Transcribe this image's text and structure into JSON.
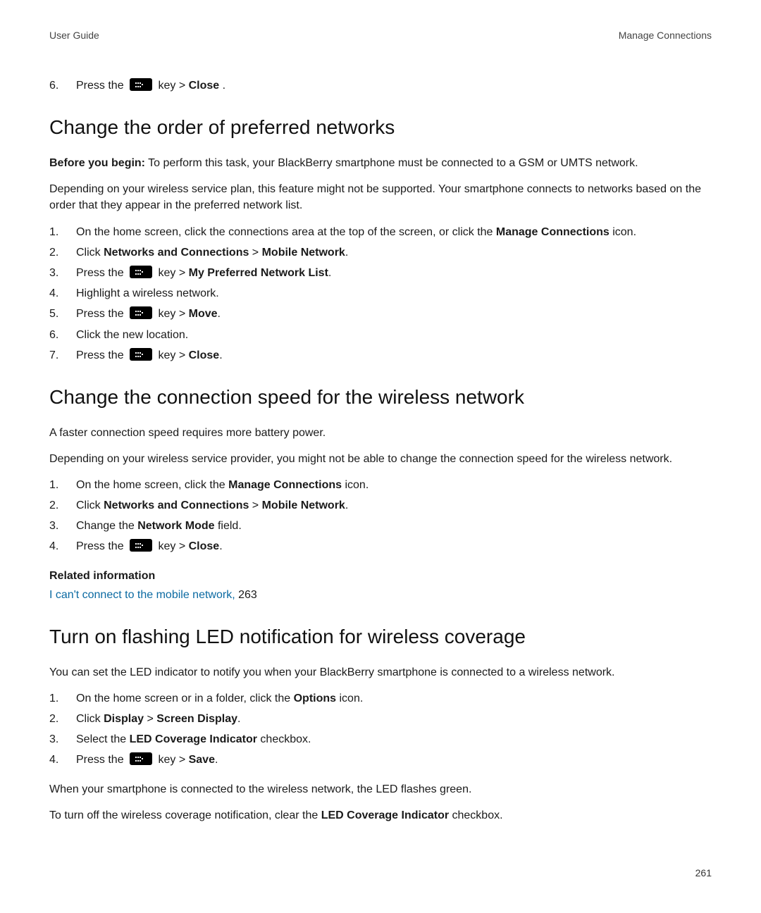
{
  "header": {
    "left": "User Guide",
    "right": "Manage Connections"
  },
  "preStep": {
    "num": "6.",
    "pre": "Press the ",
    "post": " key > ",
    "bold": "Close",
    "tail": "."
  },
  "s1": {
    "title": "Change the order of preferred networks",
    "beforeLabel": "Before you begin:",
    "beforeText": " To perform this task, your BlackBerry smartphone must be connected to a GSM or UMTS network.",
    "para2": "Depending on your wireless service plan, this feature might not be supported. Your smartphone connects to networks based on the order that they appear in the preferred network list.",
    "steps": [
      {
        "num": "1.",
        "parts": [
          {
            "t": "On the home screen, click the connections area at the top of the screen, or click the "
          },
          {
            "t": "Manage Connections",
            "b": true
          },
          {
            "t": " icon."
          }
        ]
      },
      {
        "num": "2.",
        "parts": [
          {
            "t": "Click "
          },
          {
            "t": "Networks and Connections",
            "b": true
          },
          {
            "t": " > "
          },
          {
            "t": "Mobile Network",
            "b": true
          },
          {
            "t": "."
          }
        ]
      },
      {
        "num": "3.",
        "parts": [
          {
            "t": "Press the "
          },
          {
            "icon": true
          },
          {
            "t": " key > "
          },
          {
            "t": "My Preferred Network List",
            "b": true
          },
          {
            "t": "."
          }
        ]
      },
      {
        "num": "4.",
        "parts": [
          {
            "t": "Highlight a wireless network."
          }
        ]
      },
      {
        "num": "5.",
        "parts": [
          {
            "t": "Press the "
          },
          {
            "icon": true
          },
          {
            "t": " key > "
          },
          {
            "t": "Move",
            "b": true
          },
          {
            "t": "."
          }
        ]
      },
      {
        "num": "6.",
        "parts": [
          {
            "t": "Click the new location."
          }
        ]
      },
      {
        "num": "7.",
        "parts": [
          {
            "t": "Press the "
          },
          {
            "icon": true
          },
          {
            "t": " key > "
          },
          {
            "t": "Close",
            "b": true
          },
          {
            "t": "."
          }
        ]
      }
    ]
  },
  "s2": {
    "title": "Change the connection speed for the wireless network",
    "para1": "A faster connection speed requires more battery power.",
    "para2": "Depending on your wireless service provider, you might not be able to change the connection speed for the wireless network.",
    "steps": [
      {
        "num": "1.",
        "parts": [
          {
            "t": "On the home screen, click the "
          },
          {
            "t": "Manage Connections",
            "b": true
          },
          {
            "t": " icon."
          }
        ]
      },
      {
        "num": "2.",
        "parts": [
          {
            "t": "Click "
          },
          {
            "t": "Networks and Connections",
            "b": true
          },
          {
            "t": " > "
          },
          {
            "t": "Mobile Network",
            "b": true
          },
          {
            "t": "."
          }
        ]
      },
      {
        "num": "3.",
        "parts": [
          {
            "t": "Change the "
          },
          {
            "t": "Network Mode",
            "b": true
          },
          {
            "t": " field."
          }
        ]
      },
      {
        "num": "4.",
        "parts": [
          {
            "t": "Press the "
          },
          {
            "icon": true
          },
          {
            "t": " key > "
          },
          {
            "t": "Close",
            "b": true
          },
          {
            "t": "."
          }
        ]
      }
    ],
    "relatedHead": "Related information",
    "relatedLink": "I can't connect to the mobile network,",
    "relatedPage": " 263"
  },
  "s3": {
    "title": "Turn on flashing LED notification for wireless coverage",
    "para1": "You can set the LED indicator to notify you when your BlackBerry smartphone is connected to a wireless network.",
    "steps": [
      {
        "num": "1.",
        "parts": [
          {
            "t": "On the home screen or in a folder, click the "
          },
          {
            "t": "Options",
            "b": true
          },
          {
            "t": " icon."
          }
        ]
      },
      {
        "num": "2.",
        "parts": [
          {
            "t": "Click "
          },
          {
            "t": "Display",
            "b": true
          },
          {
            "t": " > "
          },
          {
            "t": "Screen Display",
            "b": true
          },
          {
            "t": "."
          }
        ]
      },
      {
        "num": "3.",
        "parts": [
          {
            "t": "Select the "
          },
          {
            "t": "LED Coverage Indicator",
            "b": true
          },
          {
            "t": " checkbox."
          }
        ]
      },
      {
        "num": "4.",
        "parts": [
          {
            "t": "Press the "
          },
          {
            "icon": true
          },
          {
            "t": " key > "
          },
          {
            "t": "Save",
            "b": true
          },
          {
            "t": "."
          }
        ]
      }
    ],
    "para2": "When your smartphone is connected to the wireless network, the LED flashes green.",
    "para3a": "To turn off the wireless coverage notification, clear the ",
    "para3b": "LED Coverage Indicator",
    "para3c": " checkbox."
  },
  "pageNumber": "261"
}
